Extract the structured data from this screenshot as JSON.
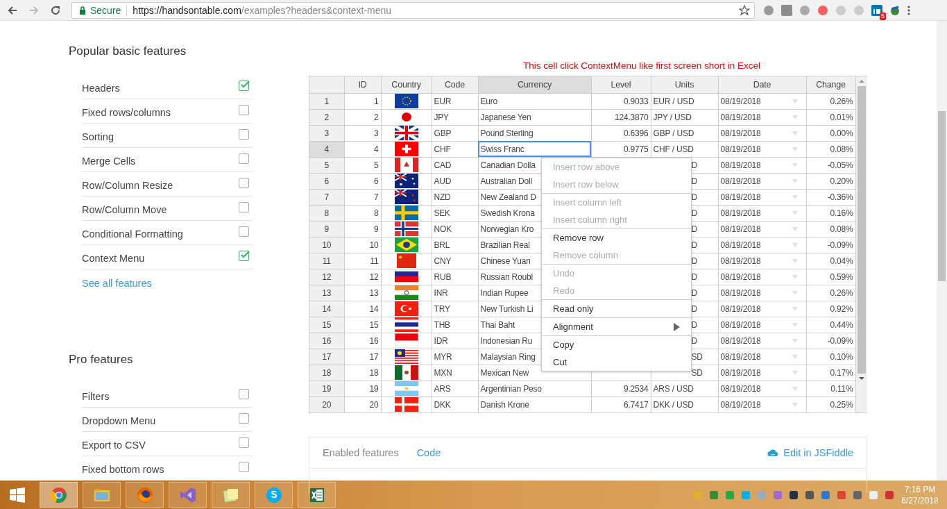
{
  "browser": {
    "secure_label": "Secure",
    "url_host": "https://handsontable.com",
    "url_path": "/examples?headers&context-menu",
    "extension_badge": "5"
  },
  "sidebar": {
    "sections": [
      {
        "title": "Popular basic features",
        "items": [
          {
            "label": "Headers",
            "checked": true
          },
          {
            "label": "Fixed rows/columns",
            "checked": false
          },
          {
            "label": "Sorting",
            "checked": false
          },
          {
            "label": "Merge Cells",
            "checked": false
          },
          {
            "label": "Row/Column Resize",
            "checked": false
          },
          {
            "label": "Row/Column Move",
            "checked": false
          },
          {
            "label": "Conditional Formatting",
            "checked": false
          },
          {
            "label": "Context Menu",
            "checked": true
          }
        ],
        "link": "See all features"
      },
      {
        "title": "Pro features",
        "items": [
          {
            "label": "Filters",
            "checked": false
          },
          {
            "label": "Dropdown Menu",
            "checked": false
          },
          {
            "label": "Export to CSV",
            "checked": false
          },
          {
            "label": "Fixed bottom rows",
            "checked": false
          }
        ]
      }
    ]
  },
  "note": "This cell click ContextMenu like first screen short in Excel",
  "table": {
    "columns": [
      {
        "label": "ID",
        "selected": false
      },
      {
        "label": "Country",
        "selected": false
      },
      {
        "label": "Code",
        "selected": false
      },
      {
        "label": "Currency",
        "selected": true
      },
      {
        "label": "Level",
        "selected": false
      },
      {
        "label": "Units",
        "selected": false
      },
      {
        "label": "Date",
        "selected": false
      },
      {
        "label": "Change",
        "selected": false
      }
    ],
    "rows": [
      {
        "header": "1",
        "id": "1",
        "code": "EUR",
        "currency": "Euro",
        "level": "0.9033",
        "units": "EUR / USD",
        "date": "08/19/2018",
        "change": "0.26%",
        "selected": false,
        "under_menu": false
      },
      {
        "header": "2",
        "id": "2",
        "code": "JPY",
        "currency": "Japanese Yen",
        "level": "124.3870",
        "units": "JPY / USD",
        "date": "08/19/2018",
        "change": "0.01%",
        "selected": false,
        "under_menu": false
      },
      {
        "header": "3",
        "id": "3",
        "code": "GBP",
        "currency": "Pound Sterling",
        "level": "0.6396",
        "units": "GBP / USD",
        "date": "08/19/2018",
        "change": "0.00%",
        "selected": false,
        "under_menu": false
      },
      {
        "header": "4",
        "id": "4",
        "code": "CHF",
        "currency": "Swiss Franc",
        "level": "0.9775",
        "units": "CHF / USD",
        "date": "08/19/2018",
        "change": "0.08%",
        "selected": true,
        "under_menu": false
      },
      {
        "header": "5",
        "id": "5",
        "code": "CAD",
        "currency": "Canadian Dolla",
        "units": "D",
        "date": "08/19/2018",
        "change": "-0.05%",
        "selected": false,
        "under_menu": true
      },
      {
        "header": "6",
        "id": "6",
        "code": "AUD",
        "currency": "Australian Doll",
        "units": "D",
        "date": "08/19/2018",
        "change": "0.20%",
        "selected": false,
        "under_menu": true
      },
      {
        "header": "7",
        "id": "7",
        "code": "NZD",
        "currency": "New Zealand D",
        "units": "D",
        "date": "08/19/2018",
        "change": "-0.36%",
        "selected": false,
        "under_menu": true
      },
      {
        "header": "8",
        "id": "8",
        "code": "SEK",
        "currency": "Swedish Krona",
        "units": "D",
        "date": "08/19/2018",
        "change": "0.16%",
        "selected": false,
        "under_menu": true
      },
      {
        "header": "9",
        "id": "9",
        "code": "NOK",
        "currency": "Norwegian Kro",
        "units": "D",
        "date": "08/19/2018",
        "change": "0.08%",
        "selected": false,
        "under_menu": true
      },
      {
        "header": "10",
        "id": "10",
        "code": "BRL",
        "currency": "Brazilian Real",
        "units": "D",
        "date": "08/19/2018",
        "change": "-0.09%",
        "selected": false,
        "under_menu": true
      },
      {
        "header": "11",
        "id": "11",
        "code": "CNY",
        "currency": "Chinese Yuan",
        "units": "D",
        "date": "08/19/2018",
        "change": "0.04%",
        "selected": false,
        "under_menu": true
      },
      {
        "header": "12",
        "id": "12",
        "code": "RUB",
        "currency": "Russian Roubl",
        "units": "D",
        "date": "08/19/2018",
        "change": "0.59%",
        "selected": false,
        "under_menu": true
      },
      {
        "header": "13",
        "id": "13",
        "code": "INR",
        "currency": "Indian Rupee",
        "units": "D",
        "date": "08/19/2018",
        "change": "0.26%",
        "selected": false,
        "under_menu": true
      },
      {
        "header": "14",
        "id": "14",
        "code": "TRY",
        "currency": "New Turkish Li",
        "units": "D",
        "date": "08/19/2018",
        "change": "0.92%",
        "selected": false,
        "under_menu": true
      },
      {
        "header": "15",
        "id": "15",
        "code": "THB",
        "currency": "Thai Baht",
        "units": "D",
        "date": "08/19/2018",
        "change": "0.44%",
        "selected": false,
        "under_menu": true
      },
      {
        "header": "16",
        "id": "16",
        "code": "IDR",
        "currency": "Indonesian Ru",
        "units": "D",
        "date": "08/19/2018",
        "change": "-0.09%",
        "selected": false,
        "under_menu": true
      },
      {
        "header": "17",
        "id": "17",
        "code": "MYR",
        "currency": "Malaysian Ring",
        "units": "SD",
        "date": "08/19/2018",
        "change": "0.10%",
        "selected": false,
        "under_menu": true
      },
      {
        "header": "18",
        "id": "18",
        "code": "MXN",
        "currency": "Mexican New",
        "units": "SD",
        "date": "08/19/2018",
        "change": "0.17%",
        "selected": false,
        "under_menu": true
      },
      {
        "header": "19",
        "id": "19",
        "code": "ARS",
        "currency": "Argentinian Peso",
        "level": "9.2534",
        "units": "ARS / USD",
        "date": "08/19/2018",
        "change": "0.11%",
        "selected": false,
        "under_menu": false
      },
      {
        "header": "20",
        "id": "20",
        "code": "DKK",
        "currency": "Danish Krone",
        "level": "6.7417",
        "units": "DKK / USD",
        "date": "08/19/2018",
        "change": "0.25%",
        "selected": false,
        "under_menu": false
      }
    ]
  },
  "context_menu": {
    "groups": [
      [
        {
          "label": "Insert row above",
          "disabled": true
        },
        {
          "label": "Insert row below",
          "disabled": true
        }
      ],
      [
        {
          "label": "Insert column left",
          "disabled": true
        },
        {
          "label": "Insert column right",
          "disabled": true
        }
      ],
      [
        {
          "label": "Remove row",
          "disabled": false
        },
        {
          "label": "Remove column",
          "disabled": true
        }
      ],
      [
        {
          "label": "Undo",
          "disabled": true
        },
        {
          "label": "Redo",
          "disabled": true
        }
      ],
      [
        {
          "label": "Read only",
          "disabled": false
        }
      ],
      [
        {
          "label": "Alignment",
          "disabled": false,
          "submenu": true
        }
      ],
      [
        {
          "label": "Copy",
          "disabled": false
        },
        {
          "label": "Cut",
          "disabled": false
        }
      ]
    ]
  },
  "bottom_panel": {
    "tabs": [
      {
        "label": "Enabled features",
        "selected": true
      },
      {
        "label": "Code",
        "selected": false
      }
    ],
    "link": "Edit in JSFiddle"
  },
  "taskbar": {
    "apps": [
      {
        "selected": true
      },
      {
        "selected": false
      },
      {
        "selected": false
      },
      {
        "selected": false
      },
      {
        "selected": false
      },
      {
        "selected": false
      },
      {
        "selected": false
      }
    ],
    "time": "7:16 PM",
    "date": "6/27/2018"
  }
}
